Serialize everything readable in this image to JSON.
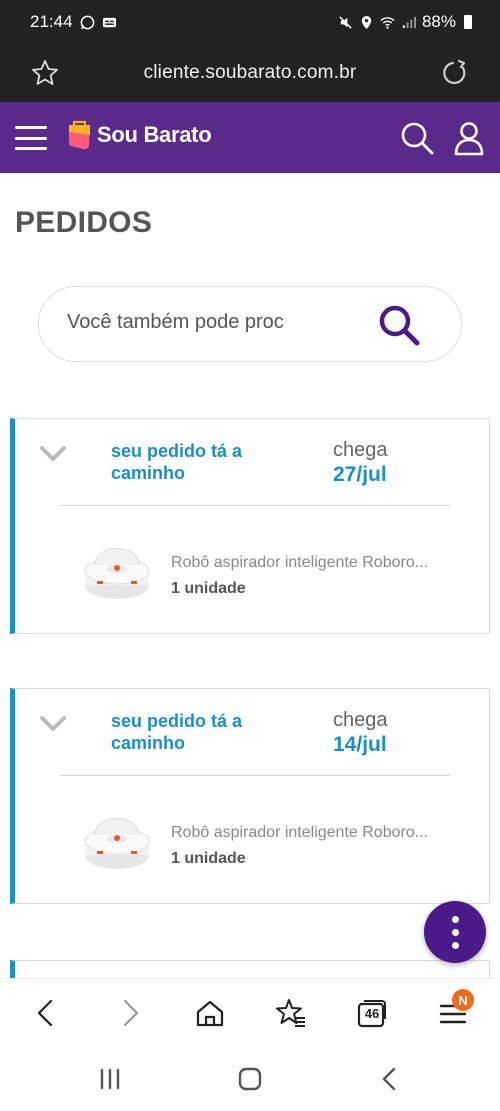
{
  "status_bar": {
    "time": "21:44",
    "battery": "88%",
    "icons": [
      "whatsapp-icon",
      "caption-icon",
      "mute-icon",
      "location-icon",
      "wifi-icon",
      "signal-icon",
      "battery-icon"
    ]
  },
  "browser": {
    "url": "cliente.soubarato.com.br",
    "tab_count": "46",
    "menu_badge": "N"
  },
  "site": {
    "brand": "Sou Barato",
    "brand_color": "#5a2a8a"
  },
  "page": {
    "title": "PEDIDOS"
  },
  "search": {
    "placeholder": "Você também pode proc"
  },
  "orders": [
    {
      "status": "seu pedido tá a caminho",
      "arrive_label": "chega",
      "arrive_date": "27/jul",
      "product_name": "Robô aspirador inteligente Roboro...",
      "quantity": "1 unidade"
    },
    {
      "status": "seu pedido tá a caminho",
      "arrive_label": "chega",
      "arrive_date": "14/jul",
      "product_name": "Robô aspirador inteligente Roboro...",
      "quantity": "1 unidade"
    }
  ],
  "colors": {
    "accent": "#1a8fc8",
    "fab": "#4b1a8a",
    "badge": "#f26b1d"
  }
}
